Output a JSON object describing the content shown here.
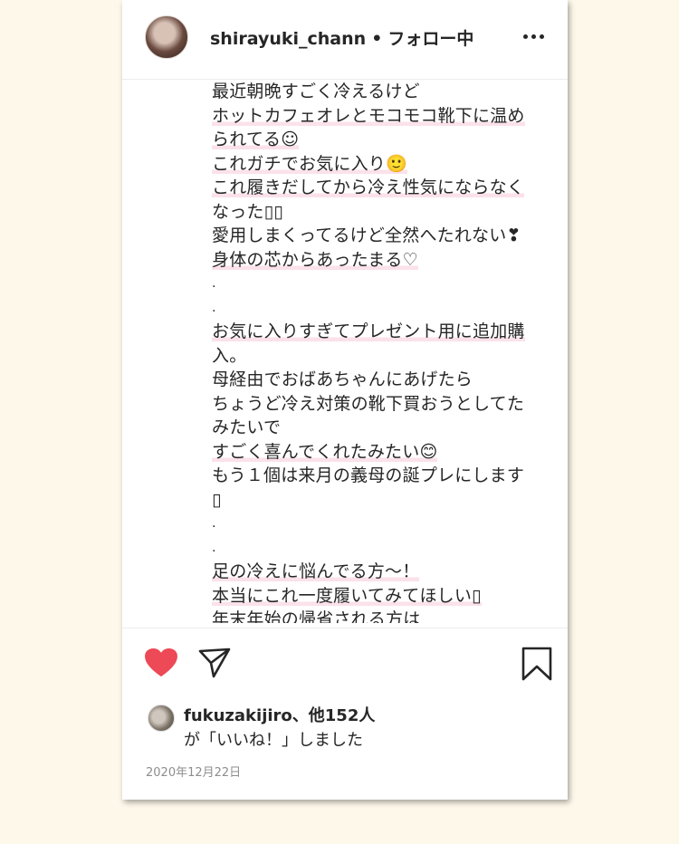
{
  "header": {
    "username": "shirayuki_chann",
    "separator": "•",
    "follow_status": "フォロー中"
  },
  "caption_lines": [
    {
      "text": "最近朝晩すごく冷えるけど",
      "hl": false
    },
    {
      "text": "ホットカフェオレとモコモコ靴下に温め",
      "hl": true
    },
    {
      "text": "られてる☺",
      "hl": true
    },
    {
      "text": "これガチでお気に入り🙂",
      "hl": true
    },
    {
      "text": "これ履きだしてから冷え性気にならなく",
      "hl": true
    },
    {
      "text": "なった▯▯",
      "hl": false
    },
    {
      "text": "愛用しまくってるけど全然へたれない❣",
      "hl": false
    },
    {
      "text": "身体の芯からあったまる♡",
      "hl": true
    },
    {
      "text": ".",
      "hl": false
    },
    {
      "text": ".",
      "hl": false
    },
    {
      "text": "お気に入りすぎてプレゼント用に追加購",
      "hl": true
    },
    {
      "text": "入。",
      "hl": false
    },
    {
      "text": "母経由でおばあちゃんにあげたら",
      "hl": false
    },
    {
      "text": "ちょうど冷え対策の靴下買おうとしてた",
      "hl": false
    },
    {
      "text": "みたいで",
      "hl": false
    },
    {
      "text": "すごく喜んでくれたみたい😊",
      "hl": true
    },
    {
      "text": "もう１個は来月の義母の誕プレにします",
      "hl": false
    },
    {
      "text": "▯",
      "hl": false
    },
    {
      "text": ".",
      "hl": false
    },
    {
      "text": ".",
      "hl": false
    },
    {
      "text": "足の冷えに悩んでる方〜！",
      "hl": true
    },
    {
      "text": "本当にこれ一度履いてみてほしい▯",
      "hl": true
    },
    {
      "text": "年末年始の帰省される方は",
      "hl": false
    }
  ],
  "likes": {
    "line1": "fukuzakijiro、他152人",
    "line2": "が「いいね！」しました"
  },
  "date": "2020年12月22日",
  "colors": {
    "background": "#fdf8ea",
    "heart": "#ed4956",
    "highlight": "#fbe1ea"
  },
  "icons": [
    "heart-icon",
    "share-icon",
    "bookmark-icon",
    "more-icon"
  ]
}
